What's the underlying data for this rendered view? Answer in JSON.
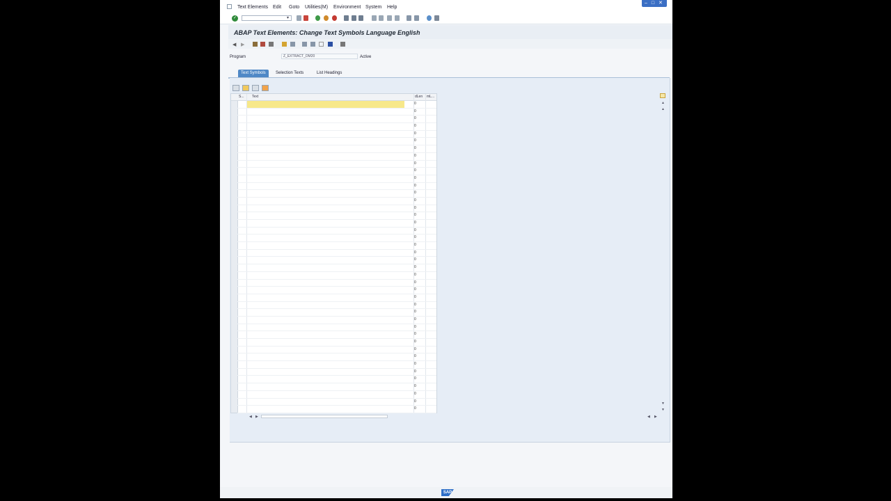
{
  "menubar": {
    "items": [
      "Text Elements",
      "Edit",
      "Goto",
      "Utilities(M)",
      "Environment",
      "System",
      "Help"
    ]
  },
  "window_controls": "– □ ✕",
  "title": "ABAP Text Elements: Change Text Symbols Language English",
  "program": {
    "label": "Program",
    "value": "Z_EXTRACT_DM20",
    "status": "Active"
  },
  "tabs": [
    {
      "label": "Text Symbols",
      "active": true
    },
    {
      "label": "Selection Texts",
      "active": false
    },
    {
      "label": "List Headings",
      "active": false
    }
  ],
  "grid": {
    "headers": {
      "sym": "S...",
      "text": "Text",
      "dlen": "dLen",
      "mlen": "mL..."
    },
    "row_len_values": [
      "0",
      "0",
      "0",
      "0",
      "0",
      "0",
      "0",
      "0",
      "0",
      "0",
      "0",
      "0",
      "0",
      "0",
      "0",
      "0",
      "0",
      "0",
      "0",
      "0",
      "0",
      "0",
      "0",
      "0",
      "0",
      "0",
      "0",
      "0",
      "0",
      "0",
      "0",
      "0",
      "0",
      "0",
      "0",
      "0",
      "0",
      "0",
      "0",
      "0",
      "0",
      "0"
    ]
  },
  "brand": "SAP"
}
